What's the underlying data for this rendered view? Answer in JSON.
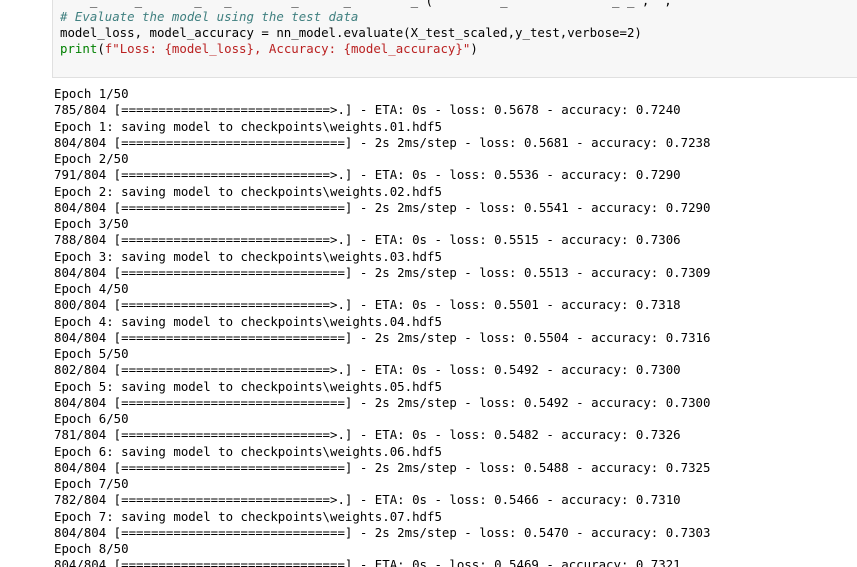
{
  "code_cell": {
    "partial_top_line": "    _     _       _   _        _      _        _ (         _              _ _ ,  ,",
    "comment": "# Evaluate the model using the test data",
    "evaluate_line": "model_loss, model_accuracy = nn_model.evaluate(X_test_scaled,y_test,verbose=2)",
    "print_fn": "print",
    "print_open": "(",
    "print_string": "f\"Loss: {model_loss}, Accuracy: {model_accuracy}\"",
    "print_close": ")"
  },
  "output": {
    "lines": [
      "Epoch 1/50",
      "785/804 [============================>.] - ETA: 0s - loss: 0.5678 - accuracy: 0.7240",
      "Epoch 1: saving model to checkpoints\\weights.01.hdf5",
      "804/804 [==============================] - 2s 2ms/step - loss: 0.5681 - accuracy: 0.7238",
      "Epoch 2/50",
      "791/804 [============================>.] - ETA: 0s - loss: 0.5536 - accuracy: 0.7290",
      "Epoch 2: saving model to checkpoints\\weights.02.hdf5",
      "804/804 [==============================] - 2s 2ms/step - loss: 0.5541 - accuracy: 0.7290",
      "Epoch 3/50",
      "788/804 [============================>.] - ETA: 0s - loss: 0.5515 - accuracy: 0.7306",
      "Epoch 3: saving model to checkpoints\\weights.03.hdf5",
      "804/804 [==============================] - 2s 2ms/step - loss: 0.5513 - accuracy: 0.7309",
      "Epoch 4/50",
      "800/804 [============================>.] - ETA: 0s - loss: 0.5501 - accuracy: 0.7318",
      "Epoch 4: saving model to checkpoints\\weights.04.hdf5",
      "804/804 [==============================] - 2s 2ms/step - loss: 0.5504 - accuracy: 0.7316",
      "Epoch 5/50",
      "802/804 [============================>.] - ETA: 0s - loss: 0.5492 - accuracy: 0.7300",
      "Epoch 5: saving model to checkpoints\\weights.05.hdf5",
      "804/804 [==============================] - 2s 2ms/step - loss: 0.5492 - accuracy: 0.7300",
      "Epoch 6/50",
      "781/804 [============================>.] - ETA: 0s - loss: 0.5482 - accuracy: 0.7326",
      "Epoch 6: saving model to checkpoints\\weights.06.hdf5",
      "804/804 [==============================] - 2s 2ms/step - loss: 0.5488 - accuracy: 0.7325",
      "Epoch 7/50",
      "782/804 [============================>.] - ETA: 0s - loss: 0.5466 - accuracy: 0.7310",
      "Epoch 7: saving model to checkpoints\\weights.07.hdf5",
      "804/804 [==============================] - 2s 2ms/step - loss: 0.5470 - accuracy: 0.7303",
      "Epoch 8/50",
      "804/804 [==============================] - ETA: 0s - loss: 0.5469 - accuracy: 0.7321"
    ]
  },
  "colors": {
    "cell_background": "#f7f7f7",
    "cell_border": "#e0e0e0",
    "comment": "#408080",
    "string": "#ba2121",
    "builtin": "#008000",
    "text": "#000000"
  }
}
